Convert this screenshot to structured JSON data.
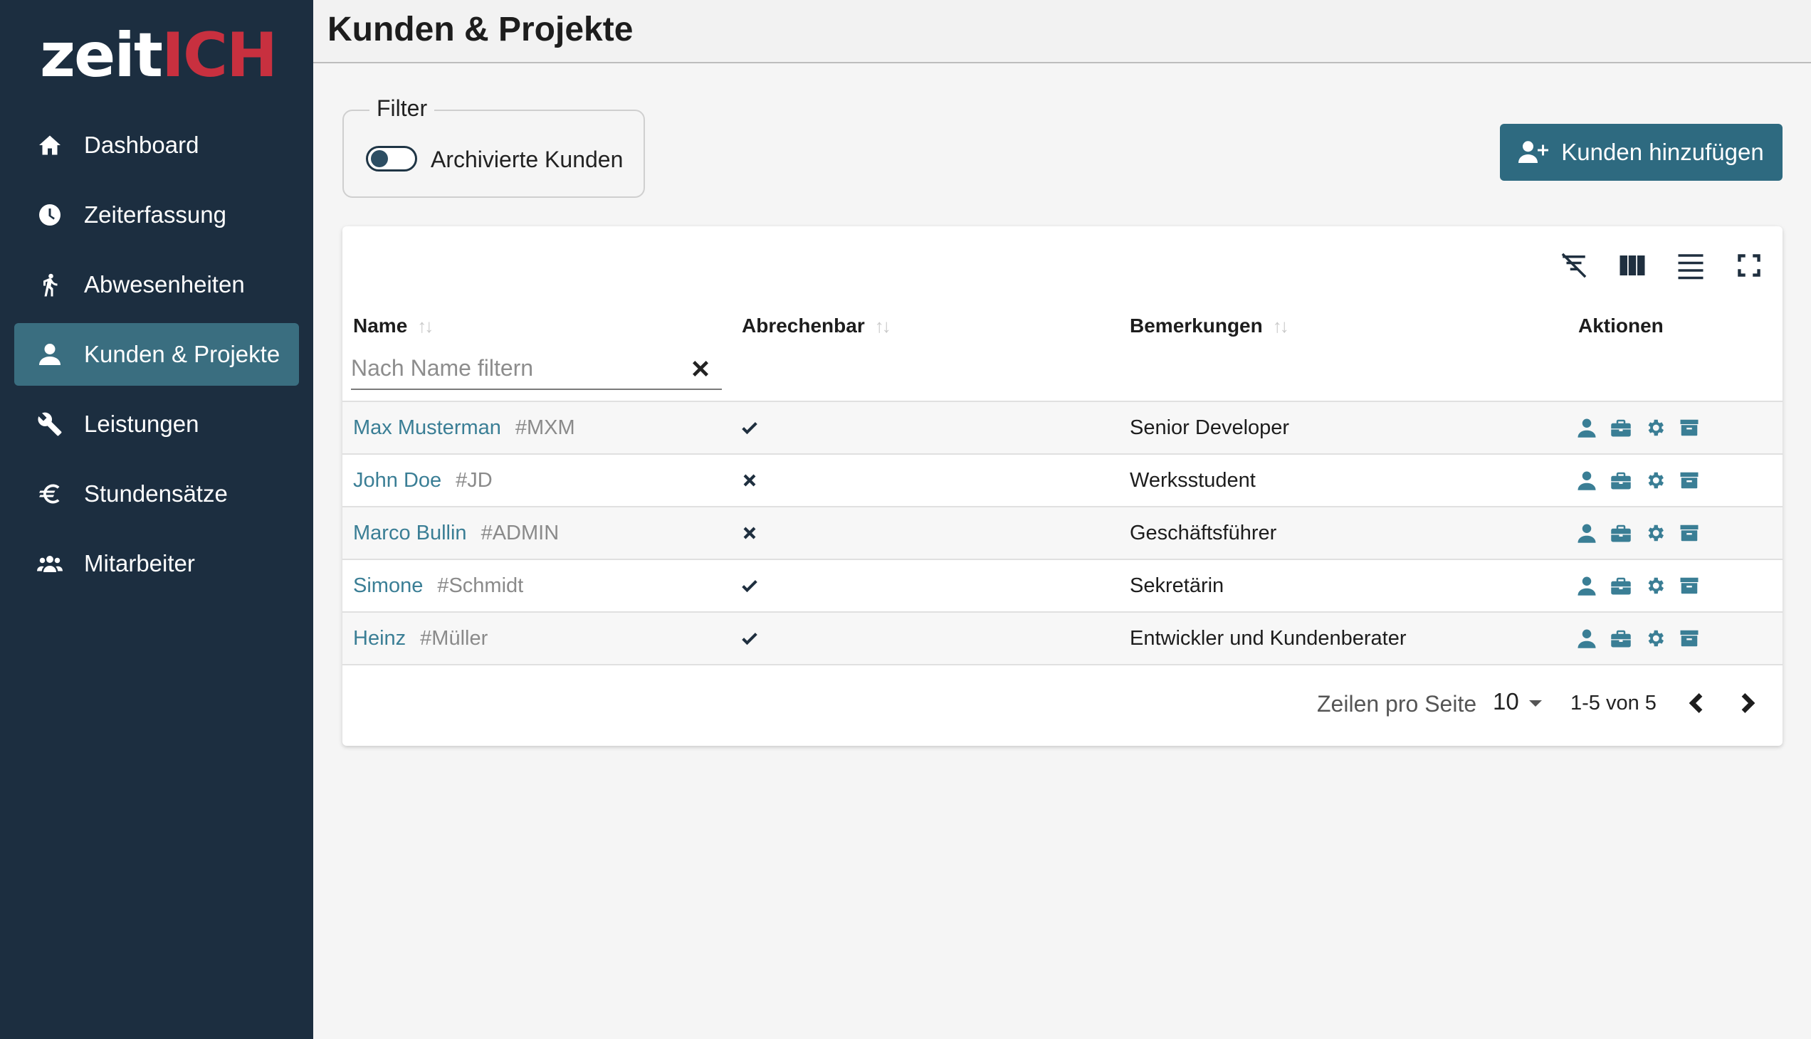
{
  "app": {
    "logo_part1": "zeit",
    "logo_part2": "ICH",
    "colors": {
      "sidebar": "#1c2e40",
      "accent": "#2e6a80",
      "link": "#3a7e95",
      "brand_red": "#c8303f"
    }
  },
  "sidebar": {
    "items": [
      {
        "label": "Dashboard",
        "icon": "home-icon",
        "active": false
      },
      {
        "label": "Zeiterfassung",
        "icon": "clock-icon",
        "active": false
      },
      {
        "label": "Abwesenheiten",
        "icon": "walking-person-icon",
        "active": false
      },
      {
        "label": "Kunden & Projekte",
        "icon": "user-icon",
        "active": true
      },
      {
        "label": "Leistungen",
        "icon": "wrench-icon",
        "active": false
      },
      {
        "label": "Stundensätze",
        "icon": "euro-icon",
        "active": false
      },
      {
        "label": "Mitarbeiter",
        "icon": "users-icon",
        "active": false
      }
    ]
  },
  "header": {
    "title": "Kunden & Projekte"
  },
  "filter": {
    "legend": "Filter",
    "archived_label": "Archivierte Kunden",
    "archived_on": false
  },
  "actions": {
    "add_customer": "Kunden hinzufügen"
  },
  "table": {
    "toolbar_icons": [
      "filter-off-icon",
      "columns-icon",
      "density-icon",
      "fullscreen-icon"
    ],
    "columns": {
      "name": "Name",
      "billable": "Abrechenbar",
      "notes": "Bemerkungen",
      "actions": "Aktionen"
    },
    "name_filter_placeholder": "Nach Name filtern",
    "rows": [
      {
        "name": "Max Musterman",
        "tag": "#MXM",
        "billable": true,
        "notes": "Senior Developer"
      },
      {
        "name": "John Doe",
        "tag": "#JD",
        "billable": false,
        "notes": "Werksstudent"
      },
      {
        "name": "Marco Bullin",
        "tag": "#ADMIN",
        "billable": false,
        "notes": "Geschäftsführer"
      },
      {
        "name": "Simone",
        "tag": "#Schmidt",
        "billable": true,
        "notes": "Sekretärin"
      },
      {
        "name": "Heinz",
        "tag": "#Müller",
        "billable": true,
        "notes": "Entwickler und Kundenberater"
      }
    ],
    "row_action_icons": [
      "user-icon",
      "briefcase-icon",
      "gear-icon",
      "archive-icon"
    ],
    "pagination": {
      "rows_per_page_label": "Zeilen pro Seite",
      "rows_per_page": "10",
      "range": "1-5 von 5"
    }
  }
}
